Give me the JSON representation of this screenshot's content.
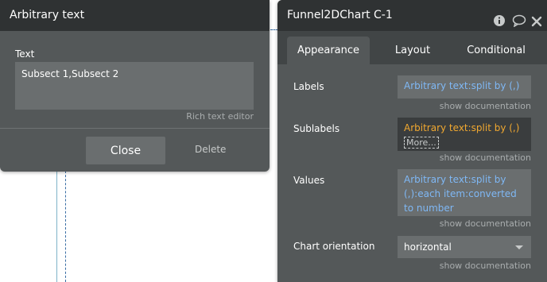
{
  "left_popup": {
    "title": "Arbitrary text",
    "field_label": "Text",
    "text_value": "Subsect 1,Subsect 2",
    "rich_text_link": "Rich text editor",
    "close_label": "Close",
    "delete_label": "Delete"
  },
  "right_panel": {
    "title": "Funnel2DChart C-1",
    "icons": [
      "info-icon",
      "comment-icon",
      "close-icon"
    ],
    "tabs": [
      {
        "label": "Appearance",
        "active": true
      },
      {
        "label": "Layout",
        "active": false
      },
      {
        "label": "Conditional",
        "active": false
      }
    ],
    "properties": {
      "labels": {
        "label": "Labels",
        "value": "Arbitrary text:split by (,)",
        "doc": "show documentation"
      },
      "sublabels": {
        "label": "Sublabels",
        "value": "Arbitrary text:split by (,)",
        "more": "More...",
        "doc": "show documentation"
      },
      "values": {
        "label": "Values",
        "value": "Arbitrary text:split by (,):each item:converted to number",
        "doc": "show documentation"
      },
      "orientation": {
        "label": "Chart orientation",
        "value": "horizontal",
        "doc": "show documentation"
      }
    }
  },
  "colors": {
    "panel_bg": "#545859",
    "header_bg": "#2f3233",
    "expression_blue": "#7fb8f5",
    "expression_orange": "#f0a830"
  }
}
